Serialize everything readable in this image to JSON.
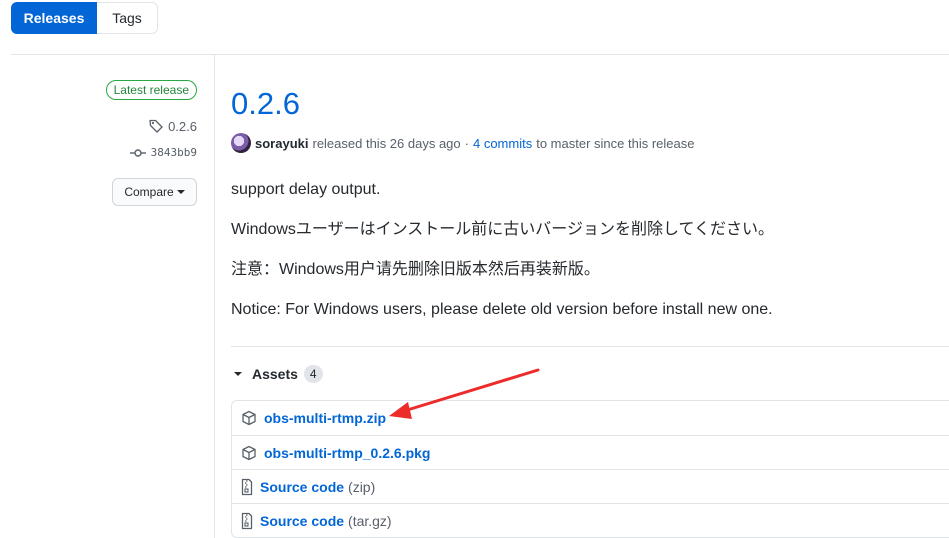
{
  "tabs": {
    "releases_label": "Releases",
    "tags_label": "Tags"
  },
  "sidebar": {
    "latest_badge": "Latest release",
    "tag": "0.2.6",
    "commit": "3843bb9",
    "compare_label": "Compare"
  },
  "release": {
    "title": "0.2.6",
    "author": "sorayuki",
    "released_text": "released this 26 days ago",
    "dot": "·",
    "commits_link": "4 commits",
    "commits_suffix": "to master since this release",
    "notes": [
      "support delay output.",
      "Windowsユーザーはインストール前に古いバージョンを削除してください。",
      "注意：Windows用户请先删除旧版本然后再装新版。",
      "Notice: For Windows users, please delete old version before install new one."
    ]
  },
  "assets": {
    "label": "Assets",
    "count": "4",
    "items": [
      {
        "name": "obs-multi-rtmp.zip",
        "suffix": "",
        "icon": "package-icon"
      },
      {
        "name": "obs-multi-rtmp_0.2.6.pkg",
        "suffix": "",
        "icon": "package-icon"
      },
      {
        "name": "Source code",
        "suffix": "(zip)",
        "icon": "file-zip-icon"
      },
      {
        "name": "Source code",
        "suffix": "(tar.gz)",
        "icon": "file-zip-icon"
      }
    ]
  },
  "colors": {
    "accent": "#0366d6",
    "success": "#28a745",
    "annotation_arrow": "#ee2b2b"
  }
}
